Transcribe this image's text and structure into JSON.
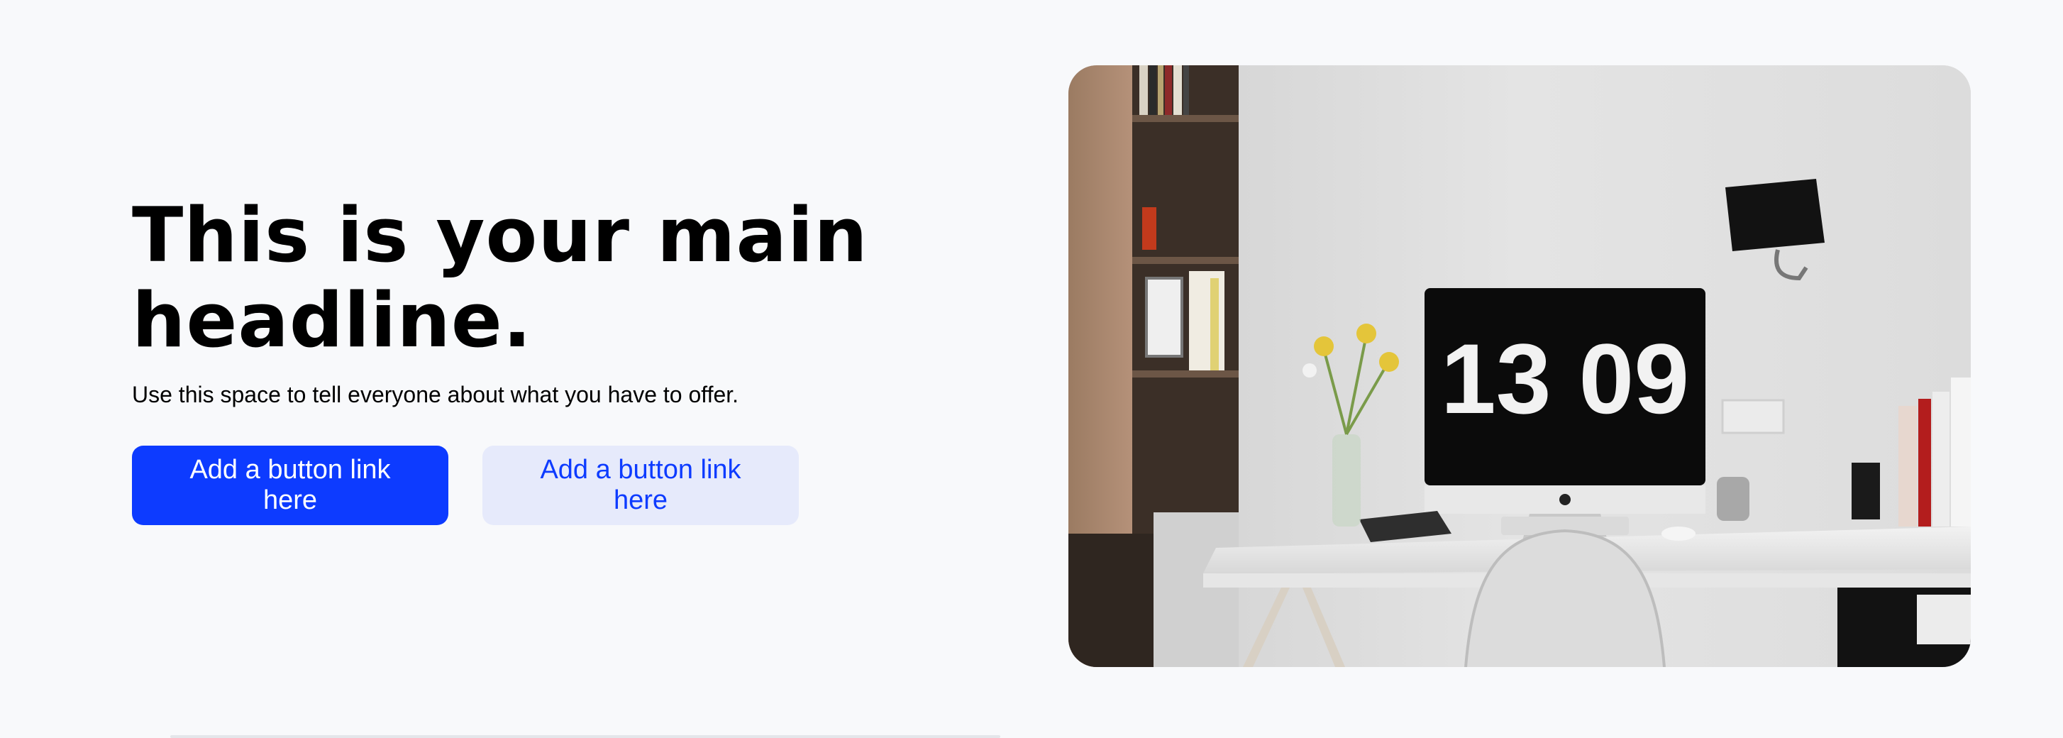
{
  "hero": {
    "headline": "This is your main headline.",
    "subline": "Use this space to tell everyone about what you have to offer.",
    "primary_button_label": "Add a button link here",
    "secondary_button_label": "Add a button link here"
  },
  "image": {
    "description_icon": "workspace-photo",
    "clock_text": "13 09"
  },
  "colors": {
    "page_background": "#f8f9fb",
    "primary_button": "#0d3bff",
    "secondary_button": "#e6eafb",
    "secondary_button_text": "#0d3bff"
  }
}
